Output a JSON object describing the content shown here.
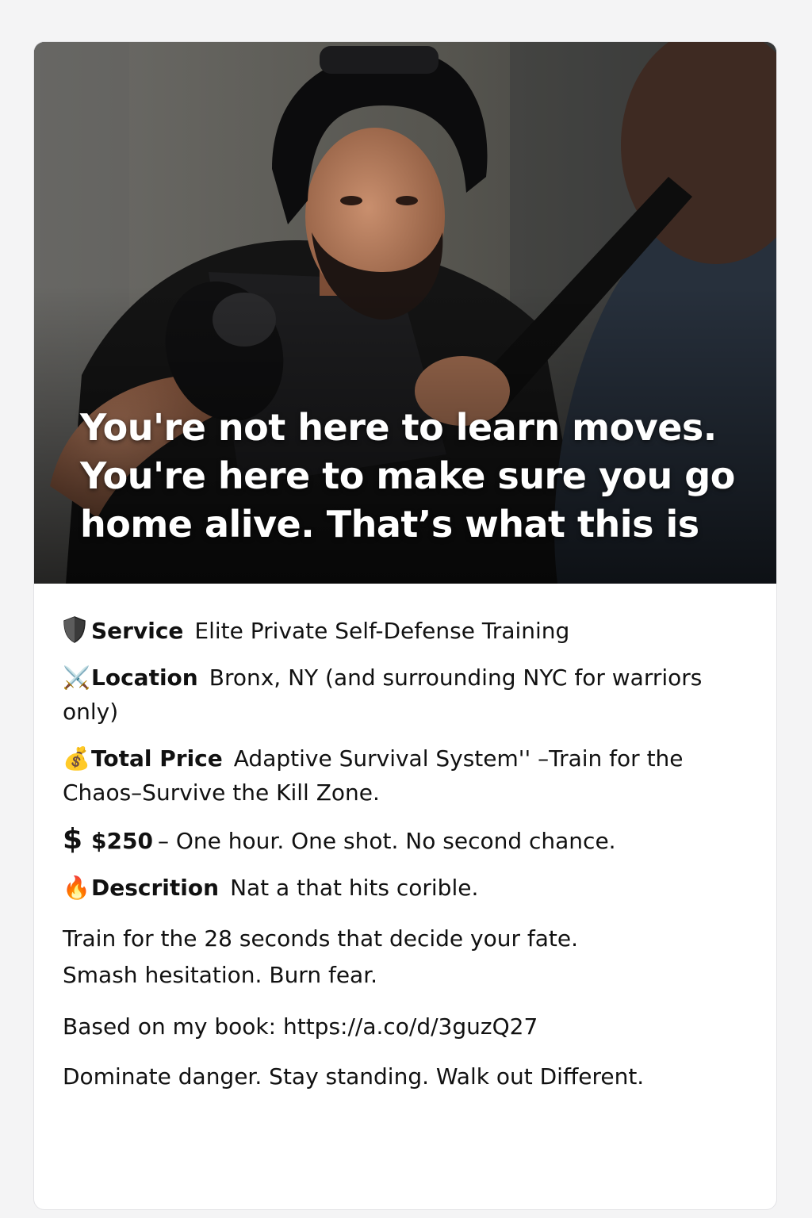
{
  "hero": {
    "headline_lines": [
      "You're not here to learn moves.",
      "You're here to make sure you go",
      "home alive. That’s what this is"
    ]
  },
  "details": {
    "service": {
      "icon": "shield-icon",
      "label": "Service",
      "value": "Elite Private Self-Defense Training"
    },
    "location": {
      "icon": "crossed-swords-icon",
      "icon_glyph": "⚔️",
      "label": "Location",
      "value": "Bronx, NY (and surrounding NYC for warriors only)"
    },
    "total_price": {
      "icon": "money-bag-icon",
      "icon_glyph": "💰",
      "label": "Total Price",
      "value": "Adaptive  Survival System'' –Train for the Chaos–Survive the Kill Zone."
    },
    "price": {
      "icon": "dollar-sign-icon",
      "icon_glyph": "$",
      "amount": "$250",
      "value": "– One hour. One shot. No second chance."
    },
    "description": {
      "icon": "fire-icon",
      "icon_glyph": "🔥",
      "label": "Descrition",
      "value": "Nat a that hits corible."
    },
    "paragraph_1": {
      "line_1": "Train for the 28 seconds that decide your fate.",
      "line_2": "Smash hesitation. Burn fear."
    },
    "book_line": "Based on my book: https://a.co/d/3guzQ27",
    "closing_line": "Dominate danger. Stay standing. Walk out Different."
  },
  "colors": {
    "page_bg": "#f4f4f5",
    "card_bg": "#ffffff",
    "text": "#111111",
    "headline": "#ffffff"
  }
}
